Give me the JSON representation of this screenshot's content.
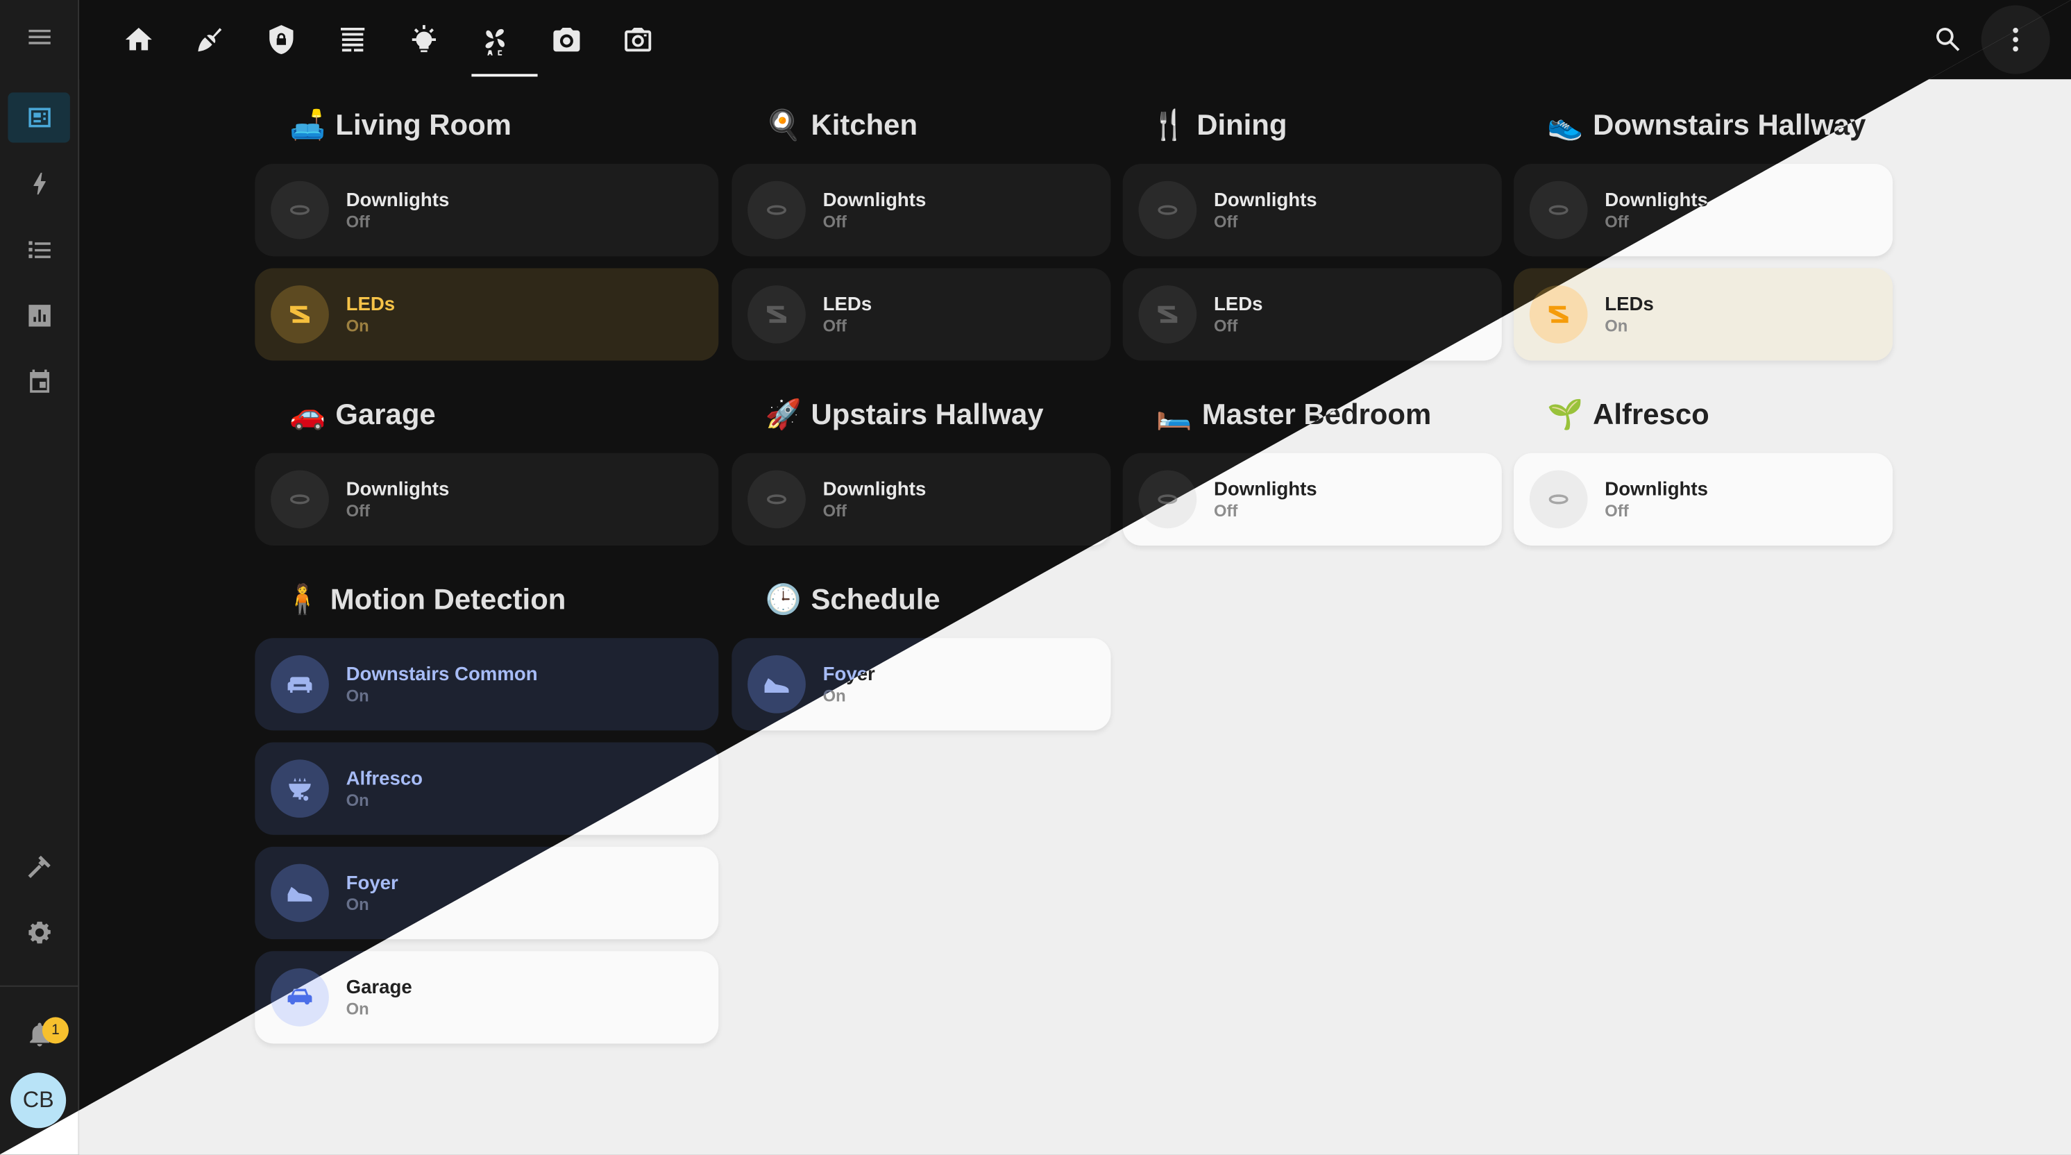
{
  "header": {
    "tabs": [
      {
        "icon": "home-icon"
      },
      {
        "icon": "broom-icon"
      },
      {
        "icon": "shield-lock-icon"
      },
      {
        "icon": "garage-door-icon"
      },
      {
        "icon": "lightbulb-on-icon",
        "active": true
      },
      {
        "icon": "fan-ac-icon"
      },
      {
        "icon": "camera-icon"
      },
      {
        "icon": "camera-outline-icon"
      }
    ],
    "actions": [
      {
        "icon": "search-icon"
      },
      {
        "icon": "dots-vertical-icon"
      }
    ]
  },
  "sidebar": {
    "items": [
      {
        "icon": "dashboard-icon",
        "active": true
      },
      {
        "icon": "lightning-bolt-icon"
      },
      {
        "icon": "list-icon"
      },
      {
        "icon": "chart-icon"
      },
      {
        "icon": "calendar-icon"
      },
      {
        "icon": "hammer-icon"
      },
      {
        "icon": "gear-icon"
      }
    ],
    "notifications": {
      "icon": "bell-icon",
      "count": "1"
    },
    "user_initials": "CB"
  },
  "sections": {
    "living_room": {
      "title": "Living Room",
      "emoji": "🛋️",
      "cards": [
        {
          "name": "Downlights",
          "state": "Off"
        },
        {
          "name": "LEDs",
          "state": "On"
        }
      ]
    },
    "kitchen": {
      "title": "Kitchen",
      "emoji": "🍳",
      "cards": [
        {
          "name": "Downlights",
          "state": "Off"
        },
        {
          "name": "LEDs",
          "state": "Off"
        }
      ]
    },
    "dining": {
      "title": "Dining",
      "emoji": "🍴",
      "cards": [
        {
          "name": "Downlights",
          "state": "Off"
        },
        {
          "name": "LEDs",
          "state": "Off"
        }
      ]
    },
    "downstairs_hallway": {
      "title": "Downstairs Hallway",
      "emoji": "👟",
      "cards": [
        {
          "name": "Downlights",
          "state": "Off"
        },
        {
          "name": "LEDs",
          "state": "On"
        }
      ]
    },
    "garage": {
      "title": "Garage",
      "emoji": "🚗",
      "cards": [
        {
          "name": "Downlights",
          "state": "Off"
        }
      ]
    },
    "upstairs_hallway": {
      "title": "Upstairs Hallway",
      "emoji": "🚀",
      "cards": [
        {
          "name": "Downlights",
          "state": "Off"
        }
      ]
    },
    "master_bedroom": {
      "title": "Master Bedroom",
      "emoji": "🛏️",
      "cards": [
        {
          "name": "Downlights",
          "state": "Off"
        }
      ]
    },
    "alfresco": {
      "title": "Alfresco",
      "emoji": "🌱",
      "cards": [
        {
          "name": "Downlights",
          "state": "Off"
        }
      ]
    },
    "motion_detection": {
      "title": "Motion Detection",
      "emoji": "🧍",
      "cards": [
        {
          "name": "Downstairs Common",
          "state": "On"
        },
        {
          "name": "Alfresco",
          "state": "On"
        },
        {
          "name": "Foyer",
          "state": "On"
        },
        {
          "name": "Garage",
          "state": "On"
        }
      ]
    },
    "schedule": {
      "title": "Schedule",
      "emoji": "🕒",
      "cards": [
        {
          "name": "Foyer",
          "state": "On"
        }
      ]
    }
  },
  "colors": {
    "dark_bg": "#111111",
    "light_bg": "#efefef",
    "accent": "#03a9f4",
    "light_on": "#f5bf3d",
    "motion_on": "#9fb4ef",
    "badge": "#f6c02e"
  }
}
